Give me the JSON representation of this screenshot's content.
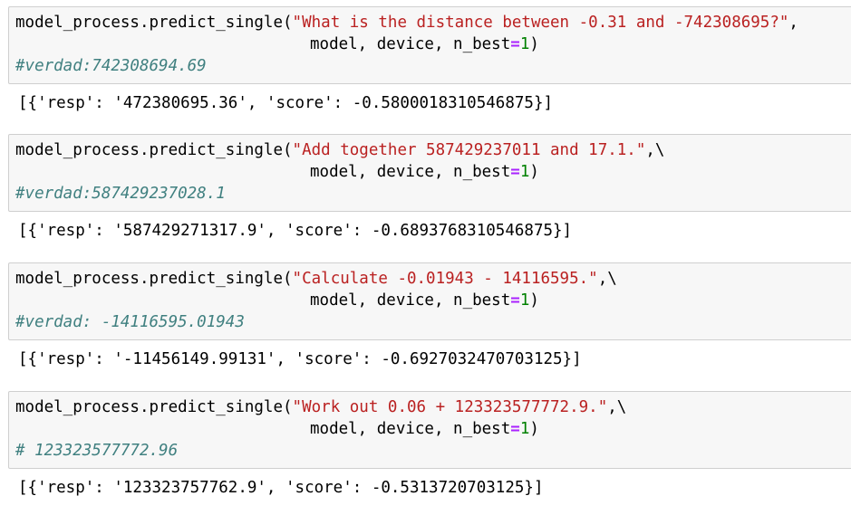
{
  "cells": [
    {
      "call": "model_process.predict_single(",
      "string_arg": "\"What is the distance between -0.31 and -742308695?\"",
      "tail": ",",
      "cont_args": "model, device, n_best",
      "eq": "=",
      "n_best_value": "1",
      "close": ")",
      "comment": "#verdad:742308694.69",
      "output": "[{'resp': '472380695.36', 'score': -0.5800018310546875}]"
    },
    {
      "call": "model_process.predict_single(",
      "string_arg": "\"Add together 587429237011 and 17.1.\"",
      "tail": ",\\",
      "cont_args": "model, device, n_best",
      "eq": "=",
      "n_best_value": "1",
      "close": ")",
      "comment": "#verdad:587429237028.1",
      "output": "[{'resp': '587429271317.9', 'score': -0.6893768310546875}]"
    },
    {
      "call": "model_process.predict_single(",
      "string_arg": "\"Calculate -0.01943 - 14116595.\"",
      "tail": ",\\",
      "cont_args": "model, device, n_best",
      "eq": "=",
      "n_best_value": "1",
      "close": ")",
      "comment": "#verdad: -14116595.01943",
      "output": "[{'resp': '-11456149.99131', 'score': -0.6927032470703125}]"
    },
    {
      "call": "model_process.predict_single(",
      "string_arg": "\"Work out 0.06 + 123323577772.9.\"",
      "tail": ",\\",
      "cont_args": "model, device, n_best",
      "eq": "=",
      "n_best_value": "1",
      "close": ")",
      "comment": "# 123323577772.96",
      "output": "[{'resp': '123323757762.9', 'score': -0.5313720703125}]"
    }
  ],
  "colors": {
    "string": "#ba2121",
    "operator": "#aa22ff",
    "number": "#008000",
    "comment": "#408080",
    "cell_background": "#f7f7f7",
    "cell_border": "#cfcfcf"
  }
}
